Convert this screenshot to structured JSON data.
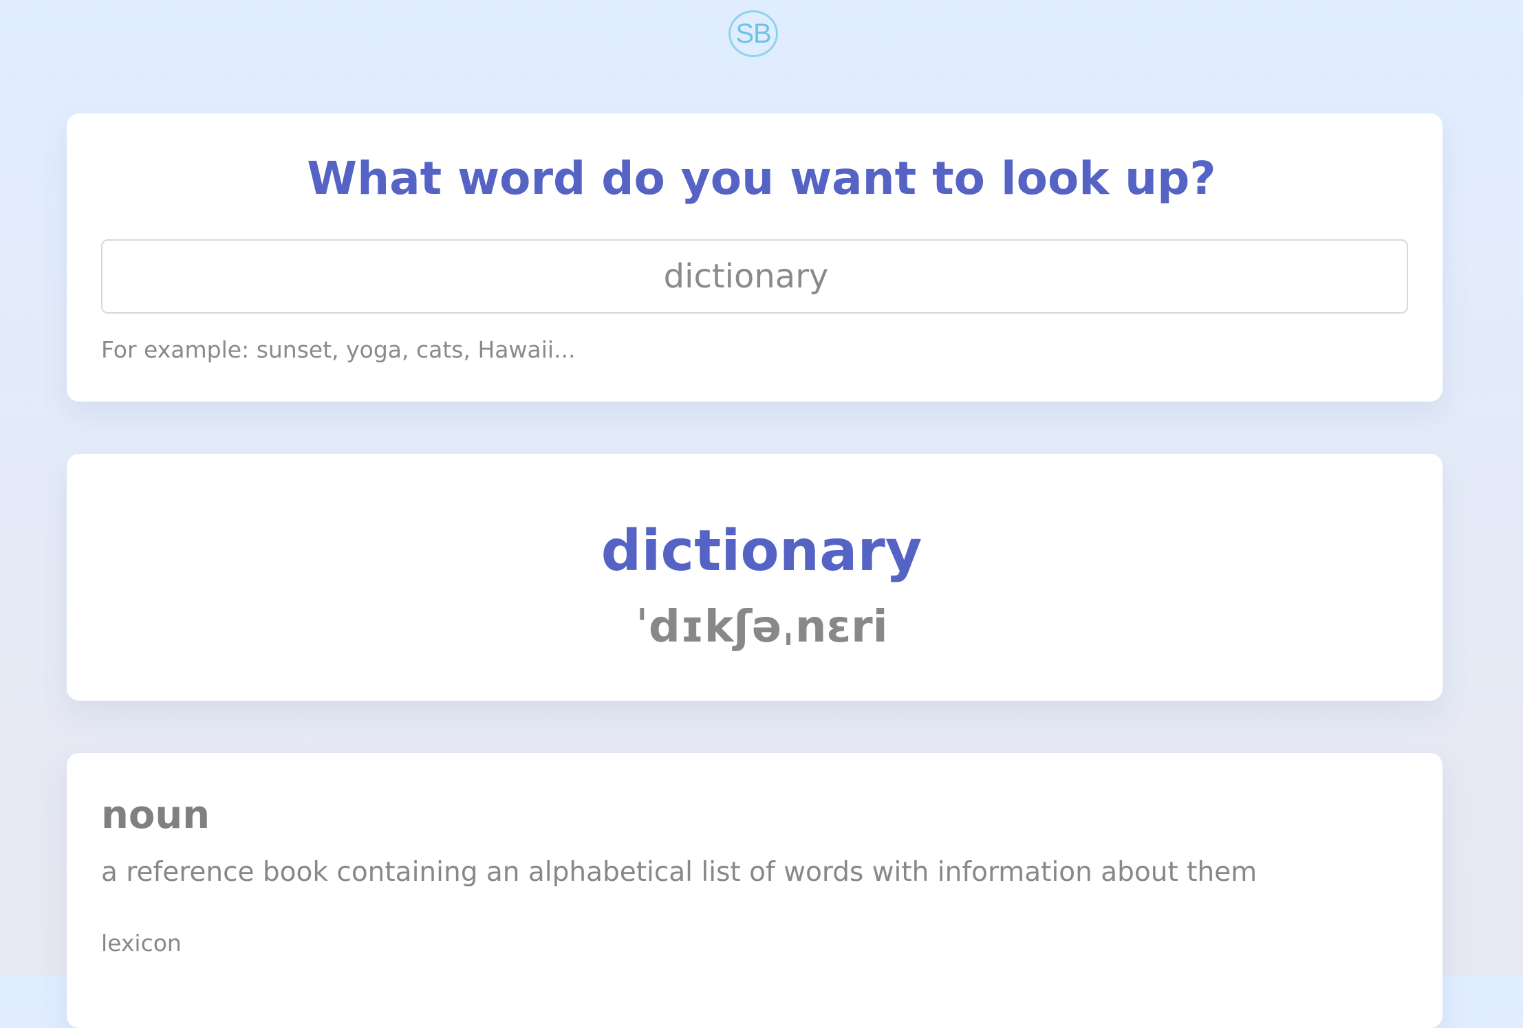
{
  "logo": {
    "text": "SB"
  },
  "search": {
    "title": "What word do you want to look up?",
    "input_value": "dictionary",
    "hint": "For example: sunset, yoga, cats, Hawaii..."
  },
  "result": {
    "word": "dictionary",
    "phonetic": "ˈdɪkʃəˌnɛri"
  },
  "meanings": [
    {
      "part_of_speech": "noun",
      "definition": "a reference book containing an alphabetical list of words with information about them",
      "synonyms": [
        "lexicon"
      ]
    }
  ],
  "colors": {
    "accent": "#5563c5",
    "logo": "#6cc3e6",
    "muted_text": "#888888",
    "background": "#e0edff"
  }
}
